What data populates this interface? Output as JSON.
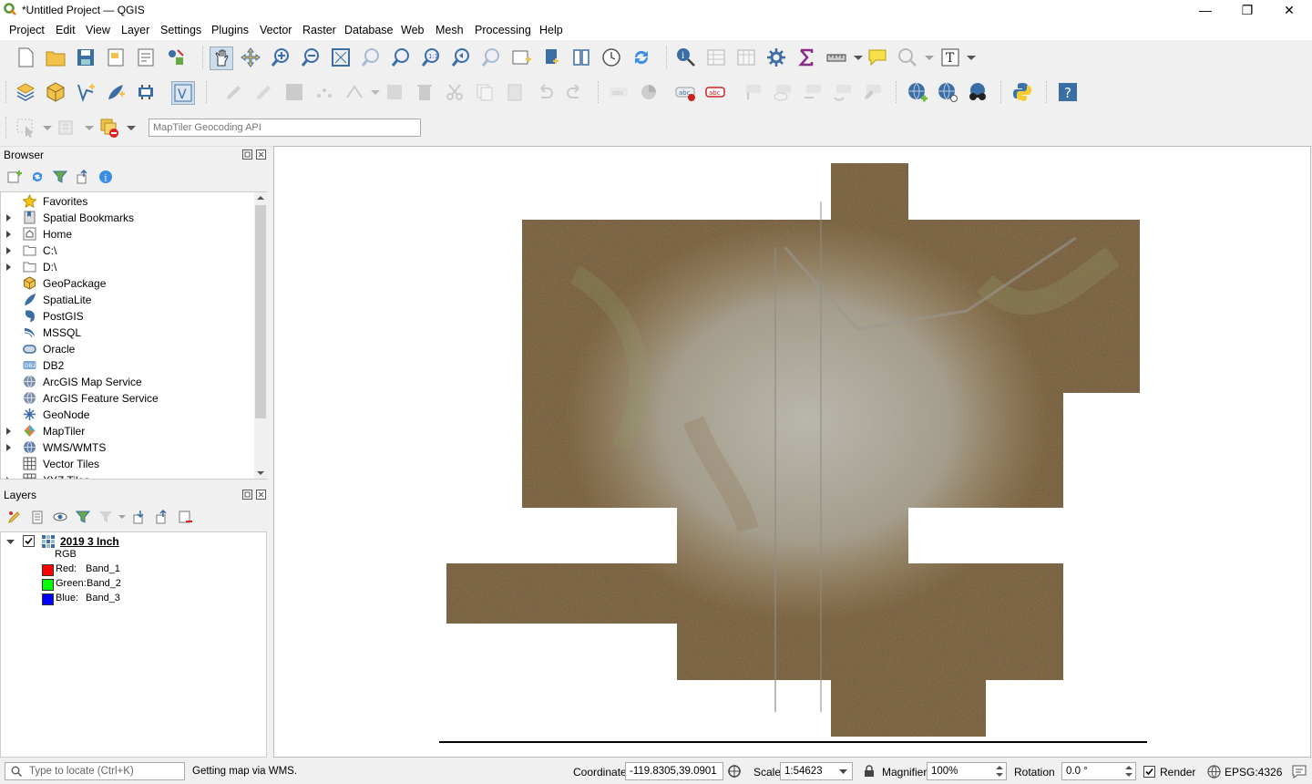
{
  "window": {
    "title": "*Untitled Project — QGIS",
    "minimize": "—",
    "restore": "❐",
    "close": "✕"
  },
  "menu": [
    "Project",
    "Edit",
    "View",
    "Layer",
    "Settings",
    "Plugins",
    "Vector",
    "Raster",
    "Database",
    "Web",
    "Mesh",
    "Processing",
    "Help"
  ],
  "geocode": {
    "placeholder": "MapTiler Geocoding API"
  },
  "browser": {
    "title": "Browser",
    "items": [
      {
        "label": "Favorites",
        "icon": "star-icon",
        "expand": false
      },
      {
        "label": "Spatial Bookmarks",
        "icon": "bookmark-icon",
        "expand": true
      },
      {
        "label": "Home",
        "icon": "home-icon",
        "expand": true
      },
      {
        "label": "C:\\",
        "icon": "drive-icon",
        "expand": true
      },
      {
        "label": "D:\\",
        "icon": "drive-icon",
        "expand": true
      },
      {
        "label": "GeoPackage",
        "icon": "geopackage-icon",
        "expand": false
      },
      {
        "label": "SpatiaLite",
        "icon": "spatialite-icon",
        "expand": false
      },
      {
        "label": "PostGIS",
        "icon": "postgis-icon",
        "expand": false
      },
      {
        "label": "MSSQL",
        "icon": "mssql-icon",
        "expand": false
      },
      {
        "label": "Oracle",
        "icon": "oracle-icon",
        "expand": false
      },
      {
        "label": "DB2",
        "icon": "db2-icon",
        "expand": false
      },
      {
        "label": "ArcGIS Map Service",
        "icon": "arcgis-map-icon",
        "expand": false
      },
      {
        "label": "ArcGIS Feature Service",
        "icon": "arcgis-feature-icon",
        "expand": false
      },
      {
        "label": "GeoNode",
        "icon": "geonode-icon",
        "expand": false
      },
      {
        "label": "MapTiler",
        "icon": "maptiler-icon",
        "expand": true
      },
      {
        "label": "WMS/WMTS",
        "icon": "wms-icon",
        "expand": true
      },
      {
        "label": "Vector Tiles",
        "icon": "vector-tiles-icon",
        "expand": false
      },
      {
        "label": "XYZ Tiles",
        "icon": "xyz-tiles-icon",
        "expand": true
      }
    ]
  },
  "layers": {
    "title": "Layers",
    "layer_name": "2019 3 Inch",
    "checked": true,
    "renderer": "RGB",
    "bands": [
      {
        "label": "Red:",
        "band": "Band_1",
        "color": "#ff0000"
      },
      {
        "label": "Green:",
        "band": "Band_2",
        "color": "#00ff00"
      },
      {
        "label": "Blue:",
        "band": "Band_3",
        "color": "#0000ff"
      }
    ]
  },
  "status": {
    "locate_placeholder": "Type to locate (Ctrl+K)",
    "message": "Getting map via WMS.",
    "coordinate_label": "Coordinate",
    "coordinate": "-119.8305,39.0901",
    "scale_label": "Scale",
    "scale": "1:54623",
    "magnifier_label": "Magnifier",
    "magnifier": "100%",
    "rotation_label": "Rotation",
    "rotation": "0.0 °",
    "render_label": "Render",
    "render_checked": true,
    "crs": "EPSG:4326"
  }
}
